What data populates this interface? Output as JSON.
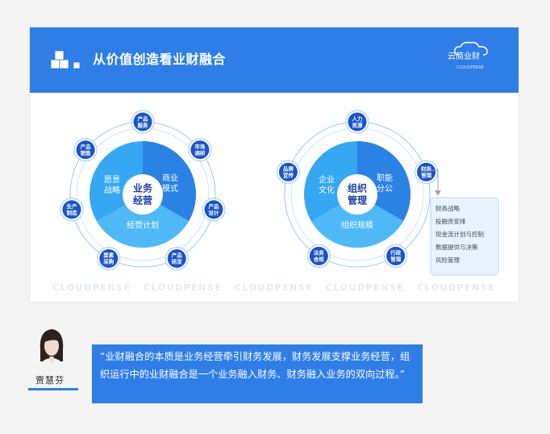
{
  "slide": {
    "title": "从价值创造看业财融合",
    "logo_text": "云简业财",
    "logo_sub": "CLOUDPENSE",
    "watermark": [
      "CLOUDPENSE",
      "CLOUDPENSE",
      "CLOUDPENSE",
      "CLOUDPENSE",
      "CLOUDPENSE"
    ]
  },
  "business_diagram": {
    "center": [
      "业务",
      "经营"
    ],
    "segments": [
      "愿景\n战略",
      "商业\n模式",
      "经营计划"
    ],
    "nodes": [
      "产品\n服务",
      "市场\n调研",
      "产品\n设计",
      "产品\n研发",
      "要素\n采购",
      "生产\n制造",
      "产品\n销售"
    ]
  },
  "org_diagram": {
    "center": [
      "组织",
      "管理"
    ],
    "segments": [
      "企业\n文化",
      "职能\n分公",
      "组织规模"
    ],
    "nodes": [
      "人力\n资源",
      "财务\n管理",
      "行政\n管理",
      "法务\n合规",
      "品牌\n宣传"
    ]
  },
  "finance_list": [
    "财务战略",
    "投融资安排",
    "现金流计划与控制",
    "数据提供与决策",
    "风险管理"
  ],
  "quote": {
    "text": "“业财融合的本质是业务经营牵引财务发展，财务发展支撑业务经营，组织运行中的业财融合是一个业务融入财务、财务融入业务的双向过程。”",
    "author": "贾慧芬"
  },
  "colors": {
    "primary": "#2f7ee8",
    "light_blue": "#35a7f3",
    "navy": "#1a3f9e",
    "pale": "#e8f3ff"
  }
}
